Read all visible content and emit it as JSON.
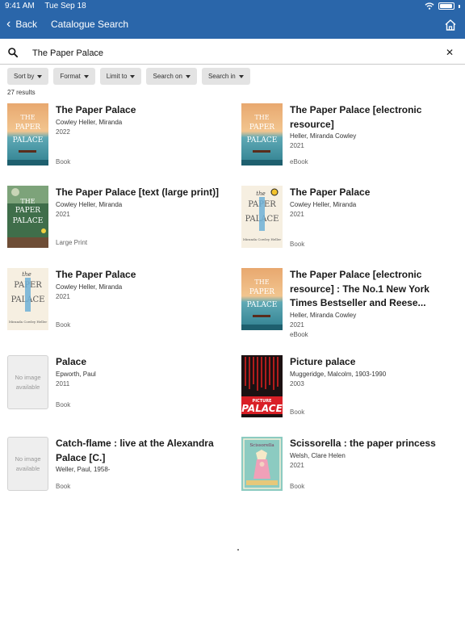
{
  "status": {
    "time": "9:41 AM",
    "date": "Tue Sep 18"
  },
  "nav": {
    "back_label": "Back",
    "title": "Catalogue Search"
  },
  "search": {
    "query": "The Paper Palace",
    "placeholder": ""
  },
  "filters": [
    "Sort by",
    "Format",
    "Limit to",
    "Search on",
    "Search in"
  ],
  "results_count": "27 results",
  "no_image_text": "No image available",
  "colors": {
    "header": "#2a66aa",
    "pill": "#e3e3e3"
  },
  "results": [
    {
      "title": "The Paper Palace",
      "author": "Cowley Heller, Miranda",
      "year": "2022",
      "format": "Book",
      "cover": "beach"
    },
    {
      "title": "The Paper Palace [electronic resource]",
      "author": "Heller, Miranda Cowley",
      "year": "2021",
      "format": "eBook",
      "cover": "beach"
    },
    {
      "title": "The Paper Palace [text (large print)]",
      "author": "Cowley Heller, Miranda",
      "year": "2021",
      "format": "Large Print",
      "cover": "green"
    },
    {
      "title": "The Paper Palace",
      "author": "Cowley Heller, Miranda",
      "year": "2021",
      "format": "Book",
      "cover": "cream"
    },
    {
      "title": "The Paper Palace",
      "author": "Cowley Heller, Miranda",
      "year": "2021",
      "format": "Book",
      "cover": "cream"
    },
    {
      "title": "The Paper Palace [electronic resource] : The No.1 New York Times Bestseller and Reese...",
      "author": "Heller, Miranda Cowley",
      "year": "2021",
      "format": "eBook",
      "cover": "beach"
    },
    {
      "title": "Palace",
      "author": "Epworth, Paul",
      "year": "2011",
      "format": "Book",
      "cover": "none"
    },
    {
      "title": "Picture palace",
      "author": "Muggeridge, Malcolm, 1903-1990",
      "year": "2003",
      "format": "Book",
      "cover": "picture"
    },
    {
      "title": "Catch-flame : live at the Alexandra Palace [C.]",
      "author": "Weller, Paul, 1958-",
      "year": "",
      "format": "Book",
      "cover": "none"
    },
    {
      "title": "Scissorella : the paper princess",
      "author": "Welsh, Clare Helen",
      "year": "2021",
      "format": "Book",
      "cover": "scissorella"
    }
  ]
}
